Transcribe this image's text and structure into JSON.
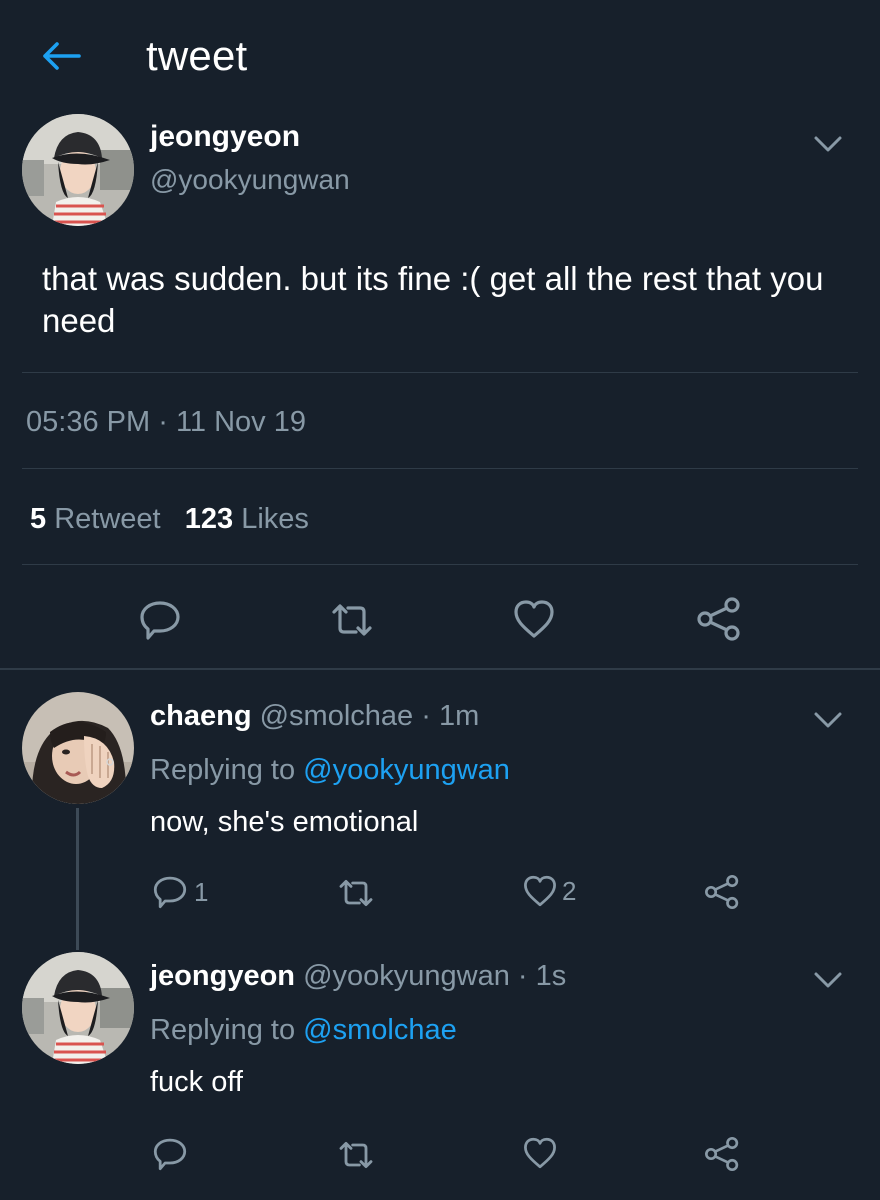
{
  "header": {
    "title": "tweet"
  },
  "main_tweet": {
    "name": "jeongyeon",
    "handle": "@yookyungwan",
    "text": "that was sudden. but its fine :( get all the rest that you need",
    "time": "05:36 PM",
    "date_sep": "·",
    "date": "11 Nov 19",
    "retweet_count": "5",
    "retweet_label": "Retweet",
    "like_count": "123",
    "like_label": "Likes"
  },
  "replies": [
    {
      "name": "chaeng",
      "handle": "@smolchae",
      "sep": "·",
      "age": "1m",
      "replying_prefix": "Replying to",
      "replying_to": "@yookyungwan",
      "text": "now, she's emotional",
      "reply_count": "1",
      "like_count": "2"
    },
    {
      "name": "jeongyeon",
      "handle": "@yookyungwan",
      "sep": "·",
      "age": "1s",
      "replying_prefix": "Replying to",
      "replying_to": "@smolchae",
      "text": "fuck off"
    }
  ],
  "colors": {
    "background": "#17202b",
    "accent": "#1da1f2",
    "muted": "#8899a6",
    "divider": "#2f3b47"
  },
  "icons": [
    "back-arrow-icon",
    "chevron-down-icon",
    "reply-icon",
    "retweet-icon",
    "like-icon",
    "share-icon"
  ]
}
